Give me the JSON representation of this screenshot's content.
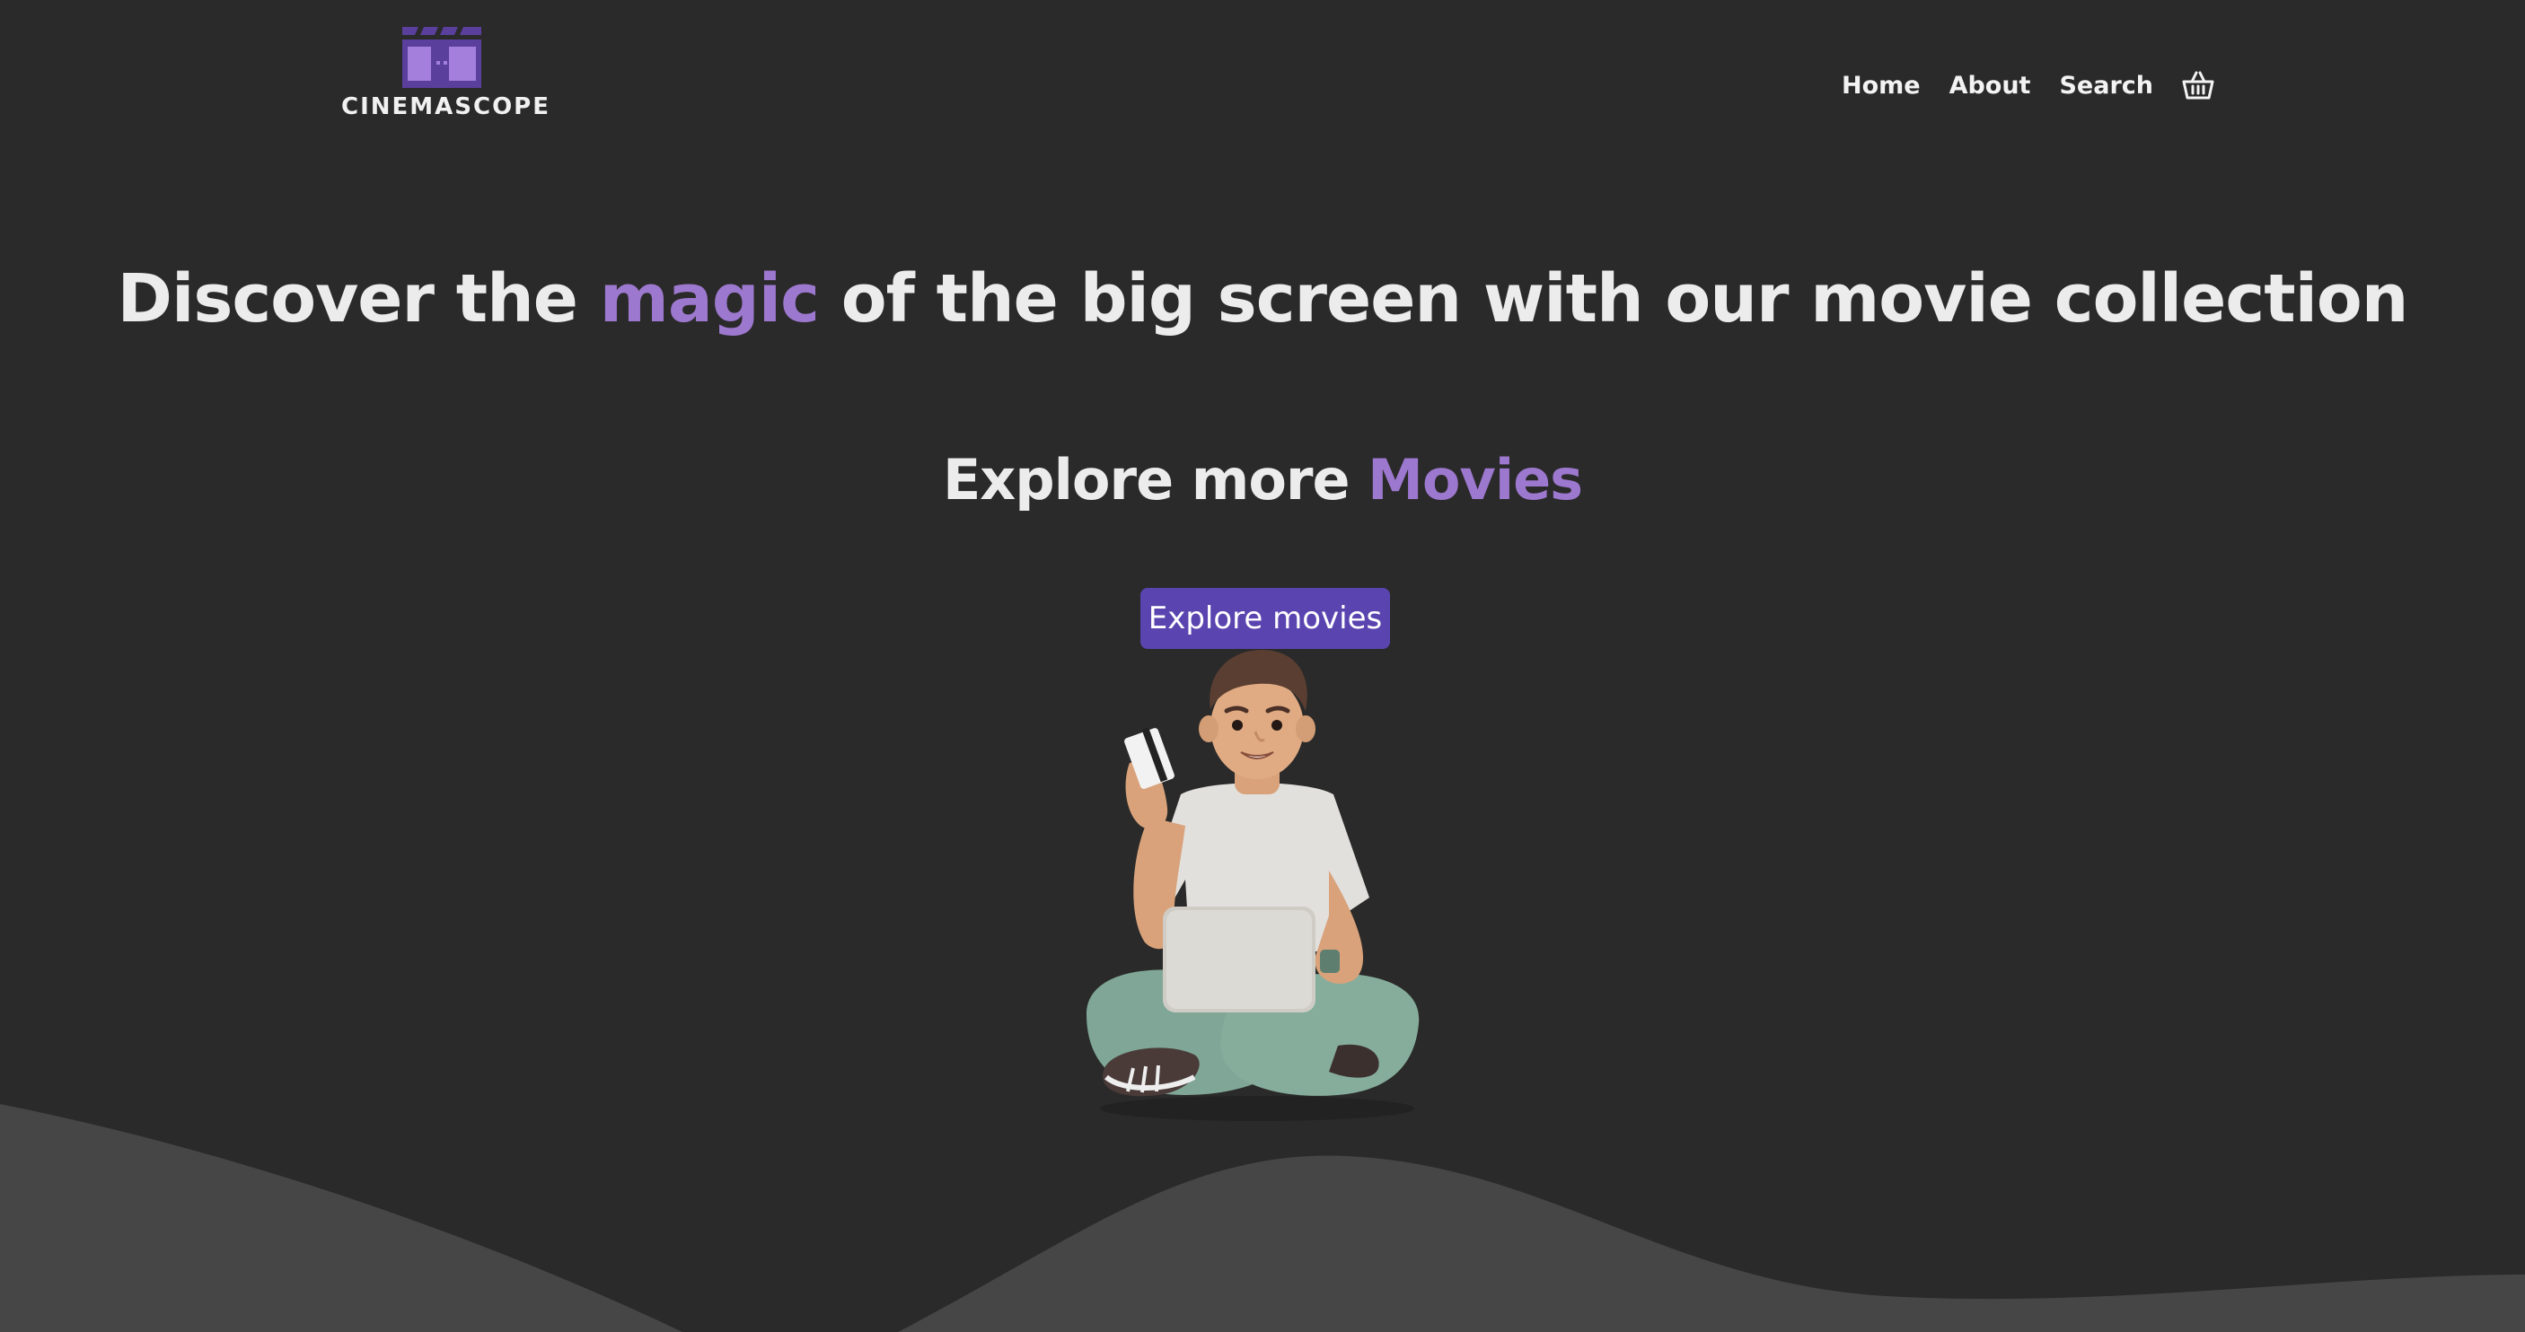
{
  "brand": {
    "name": "CINEMASCOPE",
    "accent_color": "#9d78cf",
    "button_color": "#5a45b0",
    "background_color": "#2a2a2a"
  },
  "nav": {
    "items": [
      {
        "label": "Home"
      },
      {
        "label": "About"
      },
      {
        "label": "Search"
      }
    ],
    "cart_icon": "basket-icon"
  },
  "hero": {
    "headline_before": "Discover the ",
    "headline_accent": "magic",
    "headline_after": " of the big screen with our movie collection",
    "subhead_before": "Explore more ",
    "subhead_accent": "Movies",
    "cta_label": "Explore movies",
    "illustration": "person-with-laptop-and-card-illustration"
  }
}
